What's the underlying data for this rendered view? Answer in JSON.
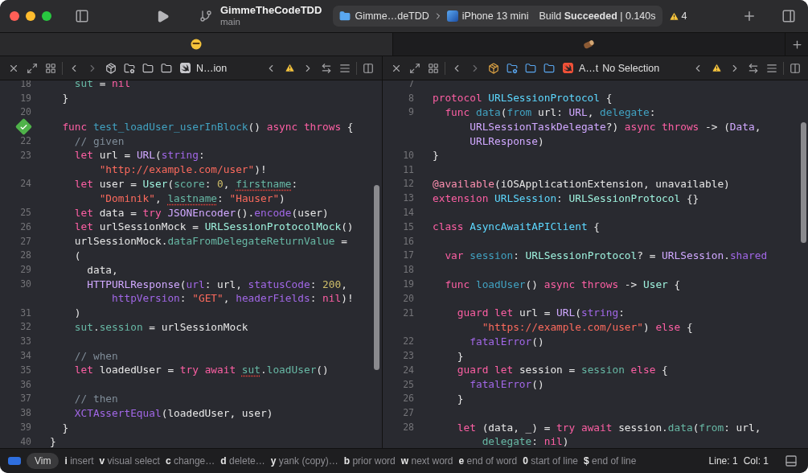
{
  "toolbar": {
    "project": "GimmeTheCodeTDD",
    "branch": "main",
    "scheme": "Gimme…deTDD",
    "device": "iPhone 13 mini",
    "build_status": "Build **Succeeded** | 0.140s",
    "warnings": "4"
  },
  "tabs": [
    {
      "selected": true
    },
    {
      "selected": false
    }
  ],
  "left": {
    "jump": [
      "N…ion"
    ],
    "lines": [
      {
        "number": "18",
        "tokens": [
          {
            "kind": "pfunc",
            "text": "    sut"
          },
          {
            "text": " = "
          },
          {
            "kind": "kw",
            "text": "nil"
          }
        ]
      },
      {
        "number": "19",
        "tokens": [
          {
            "text": "  }"
          }
        ]
      },
      {
        "number": "20"
      },
      {
        "test_passed": true,
        "tokens": [
          {
            "kind": "kw",
            "text": "  func"
          },
          {
            "kind": "fdecl",
            "text": " test_loadUser_userInBlock"
          },
          {
            "text": "() "
          },
          {
            "kind": "kw",
            "text": "async throws"
          },
          {
            "text": " {"
          }
        ]
      },
      {
        "number": "22",
        "tokens": [
          {
            "kind": "cmt",
            "text": "    // given"
          }
        ]
      },
      {
        "number": "23",
        "tokens": [
          {
            "kind": "kw",
            "text": "    let"
          },
          {
            "text": " url = "
          },
          {
            "kind": "stype",
            "text": "URL"
          },
          {
            "text": "("
          },
          {
            "kind": "sfunc",
            "text": "string"
          },
          {
            "text": ":"
          }
        ]
      },
      {
        "tokens": [
          {
            "kind": "str",
            "text": "        \"http://example.com/user\""
          },
          {
            "text": ")!"
          }
        ]
      },
      {
        "number": "24",
        "tokens": [
          {
            "kind": "kw",
            "text": "    let"
          },
          {
            "text": " user = "
          },
          {
            "kind": "ptype",
            "text": "User"
          },
          {
            "text": "("
          },
          {
            "kind": "pfunc",
            "text": "score"
          },
          {
            "text": ": "
          },
          {
            "kind": "num",
            "text": "0"
          },
          {
            "text": ", "
          },
          {
            "kind": "pfunc",
            "text": "firstname",
            "squiggle": true
          },
          {
            "text": ":"
          }
        ]
      },
      {
        "tokens": [
          {
            "kind": "str",
            "text": "        \"Dominik\""
          },
          {
            "text": ", "
          },
          {
            "kind": "pfunc",
            "text": "lastname",
            "squiggle": true
          },
          {
            "text": ": "
          },
          {
            "kind": "str",
            "text": "\"Hauser\""
          },
          {
            "text": ")"
          }
        ]
      },
      {
        "number": "25",
        "tokens": [
          {
            "kind": "kw",
            "text": "    let"
          },
          {
            "text": " data = "
          },
          {
            "kind": "kw",
            "text": "try"
          },
          {
            "kind": "stype",
            "text": " JSONEncoder"
          },
          {
            "text": "()."
          },
          {
            "kind": "sfunc",
            "text": "encode"
          },
          {
            "text": "(user)"
          }
        ]
      },
      {
        "number": "26",
        "tokens": [
          {
            "kind": "kw",
            "text": "    let"
          },
          {
            "text": " urlSessionMock = "
          },
          {
            "kind": "ptype",
            "text": "URLSessionProtocolMock"
          },
          {
            "text": "()"
          }
        ]
      },
      {
        "number": "27",
        "tokens": [
          {
            "text": "    urlSessionMock."
          },
          {
            "kind": "pfunc",
            "text": "dataFromDelegateReturnValue"
          },
          {
            "text": " ="
          }
        ]
      },
      {
        "number": "28",
        "tokens": [
          {
            "text": "    ("
          }
        ]
      },
      {
        "number": "29",
        "tokens": [
          {
            "text": "      data,"
          }
        ]
      },
      {
        "number": "30",
        "tokens": [
          {
            "kind": "stype",
            "text": "      HTTPURLResponse"
          },
          {
            "text": "("
          },
          {
            "kind": "sfunc",
            "text": "url"
          },
          {
            "text": ": url, "
          },
          {
            "kind": "sfunc",
            "text": "statusCode"
          },
          {
            "text": ": "
          },
          {
            "kind": "num",
            "text": "200"
          },
          {
            "text": ","
          }
        ]
      },
      {
        "tokens": [
          {
            "kind": "sfunc",
            "text": "          httpVersion"
          },
          {
            "text": ": "
          },
          {
            "kind": "str",
            "text": "\"GET\""
          },
          {
            "text": ", "
          },
          {
            "kind": "sfunc",
            "text": "headerFields"
          },
          {
            "text": ": "
          },
          {
            "kind": "kw",
            "text": "nil"
          },
          {
            "text": ")!"
          }
        ]
      },
      {
        "number": "31",
        "tokens": [
          {
            "text": "    )"
          }
        ]
      },
      {
        "number": "32",
        "tokens": [
          {
            "kind": "pfunc",
            "text": "    sut"
          },
          {
            "text": "."
          },
          {
            "kind": "pfunc",
            "text": "session"
          },
          {
            "text": " = urlSessionMock"
          }
        ]
      },
      {
        "number": "33"
      },
      {
        "number": "34",
        "tokens": [
          {
            "kind": "cmt",
            "text": "    // when"
          }
        ]
      },
      {
        "number": "35",
        "tokens": [
          {
            "kind": "kw",
            "text": "    let"
          },
          {
            "text": " loadedUser = "
          },
          {
            "kind": "kw",
            "text": "try await "
          },
          {
            "kind": "pfunc",
            "text": "sut",
            "squiggle": true
          },
          {
            "text": "."
          },
          {
            "kind": "pfunc",
            "text": "loadUser"
          },
          {
            "text": "()"
          }
        ]
      },
      {
        "number": "36"
      },
      {
        "number": "37",
        "tokens": [
          {
            "kind": "cmt",
            "text": "    // then"
          }
        ]
      },
      {
        "number": "38",
        "tokens": [
          {
            "kind": "sfunc",
            "text": "    XCTAssertEqual"
          },
          {
            "text": "(loadedUser, user)"
          }
        ]
      },
      {
        "number": "39",
        "tokens": [
          {
            "text": "  }"
          }
        ]
      },
      {
        "number": "40",
        "tokens": [
          {
            "text": "}"
          }
        ]
      }
    ]
  },
  "right": {
    "jump": [
      "A…t",
      "No Selection"
    ],
    "lines": [
      {
        "number": "7"
      },
      {
        "number": "8",
        "tokens": [
          {
            "kind": "kw",
            "text": "protocol"
          },
          {
            "kind": "decl",
            "text": " URLSessionProtocol"
          },
          {
            "text": " {"
          }
        ]
      },
      {
        "number": "9",
        "tokens": [
          {
            "kind": "kw",
            "text": "  func"
          },
          {
            "kind": "fdecl",
            "text": " data"
          },
          {
            "text": "("
          },
          {
            "kind": "fdecl",
            "text": "from"
          },
          {
            "text": " url: "
          },
          {
            "kind": "stype",
            "text": "URL"
          },
          {
            "text": ", "
          },
          {
            "kind": "fdecl",
            "text": "delegate"
          },
          {
            "text": ":"
          }
        ]
      },
      {
        "tokens": [
          {
            "kind": "stype",
            "text": "      URLSessionTaskDelegate"
          },
          {
            "text": "?) "
          },
          {
            "kind": "kw",
            "text": "async throws"
          },
          {
            "text": " -> ("
          },
          {
            "kind": "stype",
            "text": "Data"
          },
          {
            "text": ","
          }
        ]
      },
      {
        "tokens": [
          {
            "kind": "stype",
            "text": "      URLResponse"
          },
          {
            "text": ")"
          }
        ]
      },
      {
        "number": "10",
        "tokens": [
          {
            "text": "}"
          }
        ]
      },
      {
        "number": "11"
      },
      {
        "number": "12",
        "tokens": [
          {
            "kind": "attr",
            "text": "@available"
          },
          {
            "text": "(iOSApplicationExtension, unavailable)"
          }
        ]
      },
      {
        "number": "13",
        "tokens": [
          {
            "kind": "kw",
            "text": "extension"
          },
          {
            "kind": "decl",
            "text": " URLSession"
          },
          {
            "text": ": "
          },
          {
            "kind": "ptype",
            "text": "URLSessionProtocol"
          },
          {
            "text": " {}"
          }
        ]
      },
      {
        "number": "14"
      },
      {
        "number": "15",
        "tokens": [
          {
            "kind": "kw",
            "text": "class"
          },
          {
            "kind": "decl",
            "text": " AsyncAwaitAPIClient"
          },
          {
            "text": " {"
          }
        ]
      },
      {
        "number": "16"
      },
      {
        "number": "17",
        "tokens": [
          {
            "kind": "kw",
            "text": "  var"
          },
          {
            "kind": "fdecl",
            "text": " session"
          },
          {
            "text": ": "
          },
          {
            "kind": "ptype",
            "text": "URLSessionProtocol"
          },
          {
            "text": "? = "
          },
          {
            "kind": "stype",
            "text": "URLSession"
          },
          {
            "text": "."
          },
          {
            "kind": "sfunc",
            "text": "shared"
          }
        ]
      },
      {
        "number": "18"
      },
      {
        "number": "19",
        "tokens": [
          {
            "kind": "kw",
            "text": "  func"
          },
          {
            "kind": "fdecl",
            "text": " loadUser"
          },
          {
            "text": "() "
          },
          {
            "kind": "kw",
            "text": "async throws"
          },
          {
            "text": " -> "
          },
          {
            "kind": "ptype",
            "text": "User"
          },
          {
            "text": " {"
          }
        ]
      },
      {
        "number": "20"
      },
      {
        "number": "21",
        "tokens": [
          {
            "kind": "kw",
            "text": "    guard let"
          },
          {
            "text": " url = "
          },
          {
            "kind": "stype",
            "text": "URL"
          },
          {
            "text": "("
          },
          {
            "kind": "sfunc",
            "text": "string"
          },
          {
            "text": ":"
          }
        ]
      },
      {
        "tokens": [
          {
            "kind": "str",
            "text": "        \"https://example.com/user\""
          },
          {
            "text": ") "
          },
          {
            "kind": "kw",
            "text": "else"
          },
          {
            "text": " {"
          }
        ]
      },
      {
        "number": "22",
        "tokens": [
          {
            "kind": "sfunc",
            "text": "      fatalError"
          },
          {
            "text": "()"
          }
        ]
      },
      {
        "number": "23",
        "tokens": [
          {
            "text": "    }"
          }
        ]
      },
      {
        "number": "24",
        "tokens": [
          {
            "kind": "kw",
            "text": "    guard let"
          },
          {
            "text": " session = "
          },
          {
            "kind": "pfunc",
            "text": "session"
          },
          {
            "kind": "kw",
            "text": " else"
          },
          {
            "text": " {"
          }
        ]
      },
      {
        "number": "25",
        "tokens": [
          {
            "kind": "sfunc",
            "text": "      fatalError"
          },
          {
            "text": "()"
          }
        ]
      },
      {
        "number": "26",
        "tokens": [
          {
            "text": "    }"
          }
        ]
      },
      {
        "number": "27"
      },
      {
        "number": "28",
        "tokens": [
          {
            "kind": "kw",
            "text": "    let"
          },
          {
            "text": " (data, _) = "
          },
          {
            "kind": "kw",
            "text": "try await"
          },
          {
            "text": " session."
          },
          {
            "kind": "pfunc",
            "text": "data"
          },
          {
            "text": "("
          },
          {
            "kind": "pfunc",
            "text": "from"
          },
          {
            "text": ": url,"
          }
        ]
      },
      {
        "tokens": [
          {
            "kind": "pfunc",
            "text": "        delegate"
          },
          {
            "text": ": "
          },
          {
            "kind": "kw",
            "text": "nil"
          },
          {
            "text": ")"
          }
        ]
      }
    ]
  },
  "status_bar": {
    "mode": "Vim",
    "hints": [
      {
        "key": "i",
        "label": "insert"
      },
      {
        "key": "v",
        "label": "visual select"
      },
      {
        "key": "c",
        "label": "change…"
      },
      {
        "key": "d",
        "label": "delete…"
      },
      {
        "key": "y",
        "label": "yank (copy)…"
      },
      {
        "key": "b",
        "label": "prior word"
      },
      {
        "key": "w",
        "label": "next word"
      },
      {
        "key": "e",
        "label": "end of word"
      },
      {
        "key": "0",
        "label": "start of line"
      },
      {
        "key": "$",
        "label": "end of line"
      }
    ],
    "line": "Line: 1",
    "col": "Col: 1"
  }
}
